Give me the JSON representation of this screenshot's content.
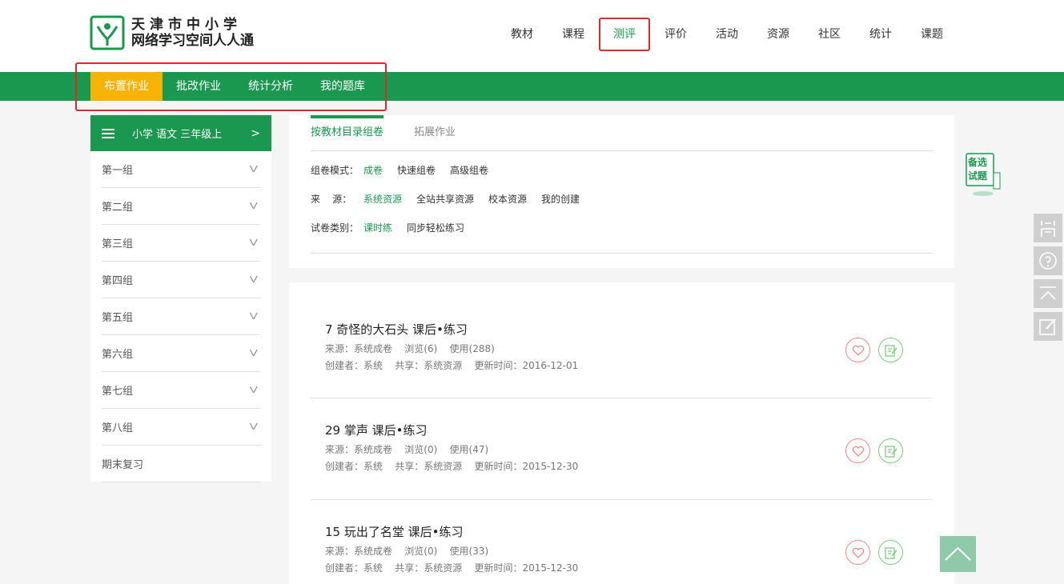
{
  "logo": {
    "line1": "天津市中小学",
    "line2": "网络学习空间人人通"
  },
  "topnav": [
    "教材",
    "课程",
    "测评",
    "评价",
    "活动",
    "资源",
    "社区",
    "统计",
    "课题"
  ],
  "subnav": [
    "布置作业",
    "批改作业",
    "统计分析",
    "我的题库"
  ],
  "sidebar": {
    "header": "小学 语文 三年级上",
    "arrow": ">",
    "items": [
      {
        "label": "第一组",
        "chev": "V"
      },
      {
        "label": "第二组",
        "chev": "V"
      },
      {
        "label": "第三组",
        "chev": "V"
      },
      {
        "label": "第四组",
        "chev": "V"
      },
      {
        "label": "第五组",
        "chev": "V"
      },
      {
        "label": "第六组",
        "chev": "V"
      },
      {
        "label": "第七组",
        "chev": "V"
      },
      {
        "label": "第八组",
        "chev": "V"
      },
      {
        "label": "期末复习",
        "chev": ""
      }
    ]
  },
  "tabs": [
    "按教材目录组卷",
    "拓展作业"
  ],
  "filters": {
    "mode": {
      "label": "组卷模式：",
      "options": [
        "成卷",
        "快速组卷",
        "高级组卷"
      ]
    },
    "source": {
      "label": "来    源：",
      "options": [
        "系统资源",
        "全站共享资源",
        "校本资源",
        "我的创建"
      ]
    },
    "type": {
      "label": "试卷类别：",
      "options": [
        "课时练",
        "同步轻松练习"
      ]
    }
  },
  "results": [
    {
      "title": "7 奇怪的大石头 课后•练习",
      "meta1": "来源：系统成卷    浏览(6)    使用(288)",
      "meta2": "创建者：系统    共享：系统资源    更新时间：2016-12-01"
    },
    {
      "title": "29 掌声 课后•练习",
      "meta1": "来源：系统成卷    浏览(0)    使用(47)",
      "meta2": "创建者：系统    共享：系统资源    更新时间：2015-12-30"
    },
    {
      "title": "15 玩出了名堂 课后•练习",
      "meta1": "来源：系统成卷    浏览(0)    使用(33)",
      "meta2": "创建者：系统    共享：系统资源    更新时间：2015-12-30"
    }
  ],
  "backup": {
    "line1": "备选",
    "line2": "试题"
  },
  "colors": {
    "green": "#1a9850",
    "orange": "#f7b300",
    "red": "#e0282b"
  },
  "icons": [
    "logo-mark-icon",
    "menu-icon",
    "heart-icon",
    "edit-icon",
    "question-icon",
    "to-top-icon",
    "pencil-icon"
  ]
}
